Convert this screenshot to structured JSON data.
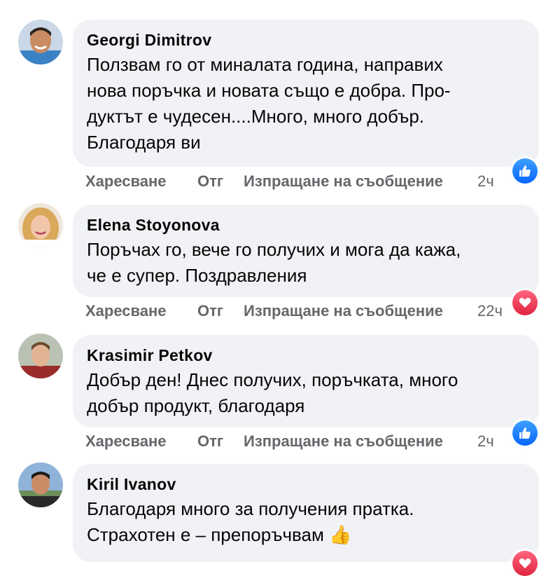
{
  "actions": {
    "like": "Харесване",
    "reply": "Отг",
    "send_message": "Изпращане на съобщение"
  },
  "comments": [
    {
      "author": "Georgi Dimitrov",
      "text": "Ползвам го от миналата година, направих\nнова поръчка и новата също е добра. Про-\nдуктът е чудесен....Много, много добър.\nБлагодаря ви",
      "time": "2ч",
      "reaction": "like-icon"
    },
    {
      "author": "Elena Stoyonova",
      "text": "Поръчах го, вече го получих и мога да кажа,\nче е супер. Поздравления",
      "time": "22ч",
      "reaction": "heart-icon"
    },
    {
      "author": "Krasimir Petkov",
      "text": "Добър ден! Днес получих, поръчката, много\nдобър продукт, благодаря",
      "time": "2ч",
      "reaction": "like-icon"
    },
    {
      "author": "Kiril Ivanov",
      "text": "Благодаря много за получения пратка.\nСтрахотен е – препоръчвам",
      "emoji": "👍",
      "reaction": "heart-icon"
    }
  ]
}
